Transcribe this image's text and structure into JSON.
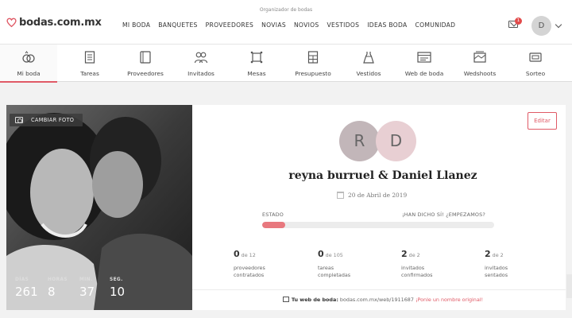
{
  "header": {
    "tagline": "Organizador de bodas",
    "logo_text": "bodas.com.mx",
    "nav": [
      "MI BODA",
      "BANQUETES",
      "PROVEEDORES",
      "NOVIAS",
      "NOVIOS",
      "VESTIDOS",
      "IDEAS BODA",
      "COMUNIDAD"
    ],
    "notification_count": "1",
    "avatar_initial": "D"
  },
  "subnav": {
    "items": [
      {
        "label": "Mi boda",
        "icon": "rings-icon"
      },
      {
        "label": "Tareas",
        "icon": "checklist-icon"
      },
      {
        "label": "Proveedores",
        "icon": "book-icon"
      },
      {
        "label": "Invitados",
        "icon": "guests-icon"
      },
      {
        "label": "Mesas",
        "icon": "table-icon"
      },
      {
        "label": "Presupuesto",
        "icon": "calculator-icon"
      },
      {
        "label": "Vestidos",
        "icon": "dress-icon"
      },
      {
        "label": "Web de boda",
        "icon": "web-icon"
      },
      {
        "label": "Wedshoots",
        "icon": "photos-icon"
      },
      {
        "label": "Sorteo",
        "icon": "ticket-icon"
      }
    ],
    "active": "Mi boda"
  },
  "photo": {
    "change_label": "CAMBIAR FOTO",
    "countdown": [
      {
        "label": "DÍAS",
        "value": "261"
      },
      {
        "label": "HORAS",
        "value": "8"
      },
      {
        "label": "MIN.",
        "value": "37"
      },
      {
        "label": "SEG.",
        "value": "10"
      }
    ]
  },
  "wedding": {
    "edit_label": "Editar",
    "initial_1": "R",
    "initial_2": "D",
    "couple": "reyna burruel & Daniel Llanez",
    "date": "20 de Abril de 2019",
    "status_label": "ESTADO",
    "status_right": "¡HAN DICHO SÍ! ¿EMPEZAMOS?",
    "progress": 0.1,
    "accent": "#e05a66"
  },
  "stats": [
    {
      "value": "0",
      "of": "de 12",
      "line1": "proveedores",
      "line2": "contratados"
    },
    {
      "value": "0",
      "of": "de 105",
      "line1": "tareas",
      "line2": "completadas"
    },
    {
      "value": "2",
      "of": "de 2",
      "line1": "invitados",
      "line2": "confirmados"
    },
    {
      "value": "2",
      "of": "de 2",
      "line1": "invitados",
      "line2": "sentados"
    }
  ],
  "web": {
    "label": "Tu web de boda:",
    "url": "bodas.com.mx/web/1911687",
    "cta": "¡Ponle un nombre original!"
  }
}
